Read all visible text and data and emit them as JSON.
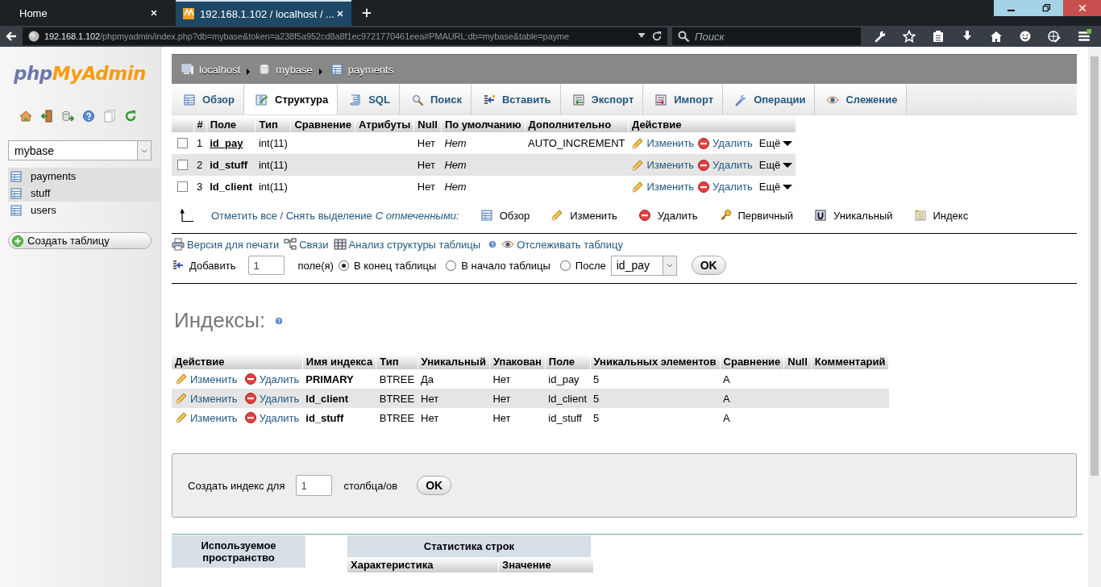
{
  "browser": {
    "tabs": [
      {
        "title": "Home",
        "selected": false
      },
      {
        "title": "192.168.1.102 / localhost / ...",
        "selected": true
      }
    ],
    "url_host": "192.168.1.102",
    "url_path": "/phpmyadmin/index.php?db=mybase&token=a238f5a952cd8a8f1ec9721770461eea#PMAURL:db=mybase&table=payme",
    "search_placeholder": "Поиск"
  },
  "sidebar": {
    "logo_php": "php",
    "logo_myadmin": "MyAdmin",
    "database": "mybase",
    "tables": [
      {
        "name": "payments",
        "selected": true
      },
      {
        "name": "stuff",
        "selected": true
      },
      {
        "name": "users",
        "selected": false
      }
    ],
    "create_table": "Создать таблицу"
  },
  "breadcrumb": [
    {
      "label": "localhost",
      "kind": "server"
    },
    {
      "label": "mybase",
      "kind": "database"
    },
    {
      "label": "payments",
      "kind": "table"
    }
  ],
  "tabs": [
    {
      "label": "Обзор",
      "kind": "browse",
      "selected": false
    },
    {
      "label": "Структура",
      "kind": "structure",
      "selected": true
    },
    {
      "label": "SQL",
      "kind": "sql",
      "selected": false
    },
    {
      "label": "Поиск",
      "kind": "search",
      "selected": false
    },
    {
      "label": "Вставить",
      "kind": "insert",
      "selected": false
    },
    {
      "label": "Экспорт",
      "kind": "export",
      "selected": false
    },
    {
      "label": "Импорт",
      "kind": "import",
      "selected": false
    },
    {
      "label": "Операции",
      "kind": "operations",
      "selected": false
    },
    {
      "label": "Слежение",
      "kind": "track",
      "selected": false
    }
  ],
  "structure": {
    "columns": [
      "#",
      "Поле",
      "Тип",
      "Сравнение",
      "Атрибуты",
      "Null",
      "По умолчанию",
      "Дополнительно",
      "Действие"
    ],
    "rows": [
      {
        "num": "1",
        "name": "id_pay",
        "type": "int(11)",
        "null": "Нет",
        "default": "Нет",
        "extra": "AUTO_INCREMENT",
        "primary": true,
        "checked": false,
        "edit": "Изменить",
        "drop": "Удалить",
        "more": "Ещё"
      },
      {
        "num": "2",
        "name": "id_stuff",
        "type": "int(11)",
        "null": "Нет",
        "default": "Нет",
        "primary": false,
        "checked": false,
        "edit": "Изменить",
        "drop": "Удалить",
        "more": "Ещё"
      },
      {
        "num": "3",
        "name": "ld_client",
        "type": "int(11)",
        "null": "Нет",
        "default": "Нет",
        "primary": false,
        "checked": false,
        "edit": "Изменить",
        "drop": "Удалить",
        "more": "Ещё"
      }
    ]
  },
  "bulk": {
    "check_all": "Отметить все / Снять выделение",
    "with_selected": "С отмеченными:",
    "actions": [
      {
        "label": "Обзор",
        "kind": "browse"
      },
      {
        "label": "Изменить",
        "kind": "edit"
      },
      {
        "label": "Удалить",
        "kind": "drop"
      },
      {
        "label": "Первичный",
        "kind": "primary"
      },
      {
        "label": "Уникальный",
        "kind": "unique"
      },
      {
        "label": "Индекс",
        "kind": "index"
      }
    ]
  },
  "links": [
    {
      "label": "Версия для печати",
      "kind": "print"
    },
    {
      "label": "Связи",
      "kind": "relations"
    },
    {
      "label": "Анализ структуры таблицы",
      "kind": "analyze"
    },
    {
      "label": "Отслеживать таблицу",
      "kind": "track"
    }
  ],
  "add_field": {
    "label": "Добавить",
    "count": "1",
    "unit": "поле(я)",
    "positions": [
      {
        "label": "В конец таблицы",
        "selected": true
      },
      {
        "label": "В начало таблицы",
        "selected": false
      },
      {
        "label": "После",
        "selected": false
      }
    ],
    "after_field": "id_pay",
    "ok": "OK"
  },
  "indexes": {
    "title": "Индексы:",
    "columns": [
      "Действие",
      "Имя индекса",
      "Тип",
      "Уникальный",
      "Упакован",
      "Поле",
      "Уникальных элементов",
      "Сравнение",
      "Null",
      "Комментарий"
    ],
    "rows": [
      {
        "edit": "Изменить",
        "drop": "Удалить",
        "name": "PRIMARY",
        "type": "BTREE",
        "unique": "Да",
        "packed": "Нет",
        "field": "id_pay",
        "cardinality": "5",
        "collation": "A"
      },
      {
        "edit": "Изменить",
        "drop": "Удалить",
        "name": "ld_client",
        "type": "BTREE",
        "unique": "Нет",
        "packed": "Нет",
        "field": "ld_client",
        "cardinality": "5",
        "collation": "A"
      },
      {
        "edit": "Изменить",
        "drop": "Удалить",
        "name": "id_stuff",
        "type": "BTREE",
        "unique": "Нет",
        "packed": "Нет",
        "field": "id_stuff",
        "cardinality": "5",
        "collation": "A"
      }
    ]
  },
  "create_index": {
    "label": "Создать индекс для",
    "count": "1",
    "unit": "столбца/ов",
    "ok": "OK"
  },
  "stats": {
    "space_title": "Используемое пространство",
    "rows_title": "Статистика строк",
    "rows_columns": [
      "Характеристика",
      "Значение"
    ]
  }
}
